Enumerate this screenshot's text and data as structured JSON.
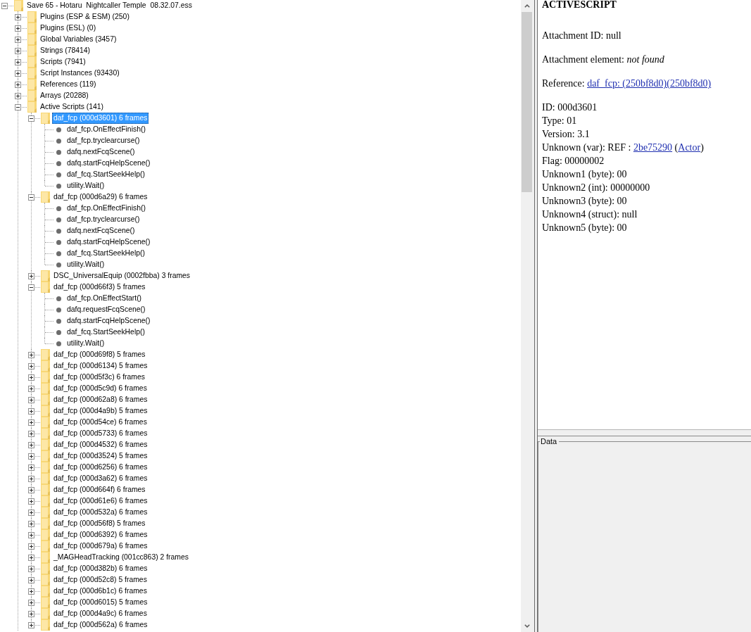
{
  "tree": {
    "items": [
      {
        "kind": "folder",
        "label": "Save 65 - Hotaru  Nightcaller Temple  08.32.07.ess",
        "expanded": true,
        "selected": false,
        "children": [
          {
            "kind": "folder",
            "label": "Plugins (ESP & ESM) (250)",
            "expanded": false,
            "selected": false
          },
          {
            "kind": "folder",
            "label": "Plugins (ESL) (0)",
            "expanded": false,
            "selected": false
          },
          {
            "kind": "folder",
            "label": "Global Variables (3457)",
            "expanded": false,
            "selected": false
          },
          {
            "kind": "folder",
            "label": "Strings (78414)",
            "expanded": false,
            "selected": false
          },
          {
            "kind": "folder",
            "label": "Scripts (7941)",
            "expanded": false,
            "selected": false
          },
          {
            "kind": "folder",
            "label": "Script Instances (93430)",
            "expanded": false,
            "selected": false
          },
          {
            "kind": "folder",
            "label": "References (119)",
            "expanded": false,
            "selected": false
          },
          {
            "kind": "folder",
            "label": "Arrays (20288)",
            "expanded": false,
            "selected": false
          },
          {
            "kind": "folder",
            "label": "Active Scripts (141)",
            "expanded": true,
            "selected": false,
            "children": [
              {
                "kind": "folder",
                "label": "daf_fcp (000d3601) 6 frames",
                "expanded": true,
                "selected": true,
                "children": [
                  {
                    "kind": "frame",
                    "label": "daf_fcp.OnEffectFinish()",
                    "selected": false
                  },
                  {
                    "kind": "frame",
                    "label": "daf_fcp.tryclearcurse()",
                    "selected": false
                  },
                  {
                    "kind": "frame",
                    "label": "dafq.nextFcqScene()",
                    "selected": false
                  },
                  {
                    "kind": "frame",
                    "label": "dafq.startFcqHelpScene()",
                    "selected": false
                  },
                  {
                    "kind": "frame",
                    "label": "daf_fcq.StartSeekHelp()",
                    "selected": false
                  },
                  {
                    "kind": "frame",
                    "label": "utility.Wait()",
                    "selected": false
                  }
                ]
              },
              {
                "kind": "folder",
                "label": "daf_fcp (000d6a29) 6 frames",
                "expanded": true,
                "selected": false,
                "children": [
                  {
                    "kind": "frame",
                    "label": "daf_fcp.OnEffectFinish()",
                    "selected": false
                  },
                  {
                    "kind": "frame",
                    "label": "daf_fcp.tryclearcurse()",
                    "selected": false
                  },
                  {
                    "kind": "frame",
                    "label": "dafq.nextFcqScene()",
                    "selected": false
                  },
                  {
                    "kind": "frame",
                    "label": "dafq.startFcqHelpScene()",
                    "selected": false
                  },
                  {
                    "kind": "frame",
                    "label": "daf_fcq.StartSeekHelp()",
                    "selected": false
                  },
                  {
                    "kind": "frame",
                    "label": "utility.Wait()",
                    "selected": false
                  }
                ]
              },
              {
                "kind": "folder",
                "label": "DSC_UniversalEquip (0002fbba) 3 frames",
                "expanded": false,
                "selected": false
              },
              {
                "kind": "folder",
                "label": "daf_fcp (000d66f3) 5 frames",
                "expanded": true,
                "selected": false,
                "children": [
                  {
                    "kind": "frame",
                    "label": "daf_fcp.OnEffectStart()",
                    "selected": false
                  },
                  {
                    "kind": "frame",
                    "label": "dafq.requestFcqScene()",
                    "selected": false
                  },
                  {
                    "kind": "frame",
                    "label": "dafq.startFcqHelpScene()",
                    "selected": false
                  },
                  {
                    "kind": "frame",
                    "label": "daf_fcq.StartSeekHelp()",
                    "selected": false
                  },
                  {
                    "kind": "frame",
                    "label": "utility.Wait()",
                    "selected": false
                  }
                ]
              },
              {
                "kind": "folder",
                "label": "daf_fcp (000d69f8) 5 frames",
                "expanded": false,
                "selected": false
              },
              {
                "kind": "folder",
                "label": "daf_fcp (000d6134) 5 frames",
                "expanded": false,
                "selected": false
              },
              {
                "kind": "folder",
                "label": "daf_fcp (000d5f3c) 6 frames",
                "expanded": false,
                "selected": false
              },
              {
                "kind": "folder",
                "label": "daf_fcp (000d5c9d) 6 frames",
                "expanded": false,
                "selected": false
              },
              {
                "kind": "folder",
                "label": "daf_fcp (000d62a8) 6 frames",
                "expanded": false,
                "selected": false
              },
              {
                "kind": "folder",
                "label": "daf_fcp (000d4a9b) 5 frames",
                "expanded": false,
                "selected": false
              },
              {
                "kind": "folder",
                "label": "daf_fcp (000d54ce) 6 frames",
                "expanded": false,
                "selected": false
              },
              {
                "kind": "folder",
                "label": "daf_fcp (000d5733) 6 frames",
                "expanded": false,
                "selected": false
              },
              {
                "kind": "folder",
                "label": "daf_fcp (000d4532) 6 frames",
                "expanded": false,
                "selected": false
              },
              {
                "kind": "folder",
                "label": "daf_fcp (000d3524) 5 frames",
                "expanded": false,
                "selected": false
              },
              {
                "kind": "folder",
                "label": "daf_fcp (000d6256) 6 frames",
                "expanded": false,
                "selected": false
              },
              {
                "kind": "folder",
                "label": "daf_fcp (000d3a62) 6 frames",
                "expanded": false,
                "selected": false
              },
              {
                "kind": "folder",
                "label": "daf_fcp (000d664f) 6 frames",
                "expanded": false,
                "selected": false
              },
              {
                "kind": "folder",
                "label": "daf_fcp (000d61e6) 6 frames",
                "expanded": false,
                "selected": false
              },
              {
                "kind": "folder",
                "label": "daf_fcp (000d532a) 6 frames",
                "expanded": false,
                "selected": false
              },
              {
                "kind": "folder",
                "label": "daf_fcp (000d56f8) 5 frames",
                "expanded": false,
                "selected": false
              },
              {
                "kind": "folder",
                "label": "daf_fcp (000d6392) 6 frames",
                "expanded": false,
                "selected": false
              },
              {
                "kind": "folder",
                "label": "daf_fcp (000d679a) 6 frames",
                "expanded": false,
                "selected": false
              },
              {
                "kind": "folder",
                "label": "_MAGHeadTracking (001cc863) 2 frames",
                "expanded": false,
                "selected": false
              },
              {
                "kind": "folder",
                "label": "daf_fcp (000d382b) 6 frames",
                "expanded": false,
                "selected": false
              },
              {
                "kind": "folder",
                "label": "daf_fcp (000d52c8) 5 frames",
                "expanded": false,
                "selected": false
              },
              {
                "kind": "folder",
                "label": "daf_fcp (000d6b1c) 6 frames",
                "expanded": false,
                "selected": false
              },
              {
                "kind": "folder",
                "label": "daf_fcp (000d6015) 5 frames",
                "expanded": false,
                "selected": false
              },
              {
                "kind": "folder",
                "label": "daf_fcp (000d4a9c) 6 frames",
                "expanded": false,
                "selected": false
              },
              {
                "kind": "folder",
                "label": "daf_fcp (000d562a) 6 frames",
                "expanded": false,
                "selected": false
              }
            ]
          }
        ]
      }
    ]
  },
  "details": {
    "title": "ACTIVESCRIPT",
    "blocks": [
      {
        "lines": [
          [
            {
              "kind": "text",
              "text": "Attachment ID: null"
            }
          ]
        ]
      },
      {
        "lines": [
          [
            {
              "kind": "text",
              "text": "Attachment element: *not found*"
            }
          ]
        ]
      },
      {
        "lines": [
          [
            {
              "kind": "text",
              "text": "Reference: "
            },
            {
              "kind": "link",
              "text": "daf_fcp: (250bf8d0)(250bf8d0)"
            }
          ]
        ]
      },
      {
        "lines": [
          [
            {
              "kind": "text",
              "text": "ID: 000d3601"
            }
          ],
          [
            {
              "kind": "text",
              "text": "Type: 01"
            }
          ],
          [
            {
              "kind": "text",
              "text": "Version: 3.1"
            }
          ],
          [
            {
              "kind": "text",
              "text": "Unknown (var): REF : "
            },
            {
              "kind": "link",
              "text": "2be75290"
            },
            {
              "kind": "text",
              "text": " ("
            },
            {
              "kind": "link",
              "text": "Actor"
            },
            {
              "kind": "text",
              "text": ")"
            }
          ],
          [
            {
              "kind": "text",
              "text": "Flag: 00000002"
            }
          ],
          [
            {
              "kind": "text",
              "text": "Unknown1 (byte): 00"
            }
          ],
          [
            {
              "kind": "text",
              "text": "Unknown2 (int): 00000000"
            }
          ],
          [
            {
              "kind": "text",
              "text": "Unknown3 (byte): 00"
            }
          ],
          [
            {
              "kind": "text",
              "text": "Unknown4 (struct): null"
            }
          ],
          [
            {
              "kind": "text",
              "text": "Unknown5 (byte): 00"
            }
          ]
        ]
      }
    ]
  },
  "data_panel": {
    "title": "Data"
  }
}
